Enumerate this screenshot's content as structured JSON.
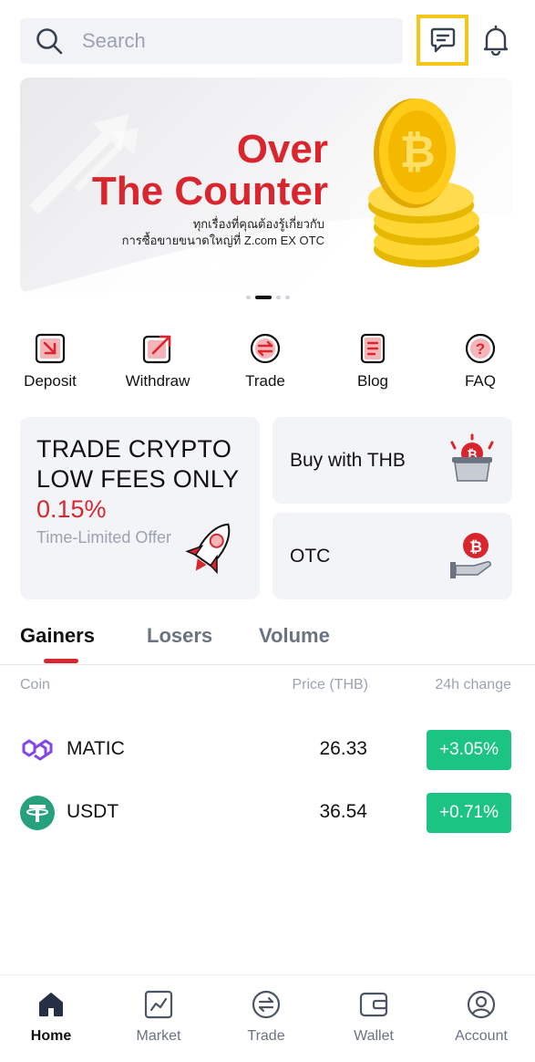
{
  "search": {
    "placeholder": "Search",
    "icon": "search-icon"
  },
  "header": {
    "chat_icon": "chat-icon",
    "bell_icon": "bell-icon",
    "highlight_color": "#f5c518"
  },
  "banner": {
    "title_line1": "Over",
    "title_line2": "The Counter",
    "subtitle_line1": "ทุกเรื่องที่คุณต้องรู้เกี่ยวกับ",
    "subtitle_line2": "การซื้อขายขนาดใหญ่ที่ Z.com EX OTC",
    "slides_total": 4,
    "active_slide": 2
  },
  "quick_actions": [
    {
      "label": "Deposit",
      "icon": "deposit-icon"
    },
    {
      "label": "Withdraw",
      "icon": "withdraw-icon"
    },
    {
      "label": "Trade",
      "icon": "trade-icon"
    },
    {
      "label": "Blog",
      "icon": "blog-icon"
    },
    {
      "label": "FAQ",
      "icon": "faq-icon"
    }
  ],
  "promo": {
    "line1": "TRADE CRYPTO",
    "line2": "LOW FEES ONLY",
    "rate": "0.15%",
    "note": "Time-Limited Offer",
    "icon": "rocket-icon"
  },
  "cards": {
    "buy_thb": {
      "label": "Buy with THB",
      "icon": "bitcoin-basket-icon"
    },
    "otc": {
      "label": "OTC",
      "icon": "bitcoin-hand-icon"
    }
  },
  "tabs": [
    "Gainers",
    "Losers",
    "Volume"
  ],
  "active_tab": "Gainers",
  "table": {
    "headers": {
      "coin": "Coin",
      "price": "Price (THB)",
      "change": "24h change"
    },
    "rows": [
      {
        "coin": "MATIC",
        "price": "26.33",
        "change": "+3.05%",
        "icon": "matic-icon"
      },
      {
        "coin": "USDT",
        "price": "36.54",
        "change": "+0.71%",
        "icon": "usdt-icon"
      }
    ]
  },
  "bottom_nav": [
    {
      "label": "Home",
      "icon": "home-icon",
      "active": true
    },
    {
      "label": "Market",
      "icon": "market-icon"
    },
    {
      "label": "Trade",
      "icon": "trade-nav-icon"
    },
    {
      "label": "Wallet",
      "icon": "wallet-icon"
    },
    {
      "label": "Account",
      "icon": "account-icon"
    }
  ],
  "colors": {
    "brand_red": "#d9262e",
    "positive_green": "#1cc484",
    "card_bg": "#f3f4f7"
  }
}
